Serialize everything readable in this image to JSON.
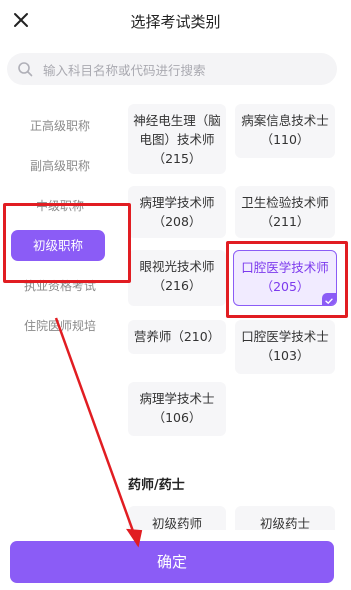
{
  "header": {
    "title": "选择考试类别",
    "close_icon": "close-icon"
  },
  "search": {
    "placeholder": "输入科目名称或代码进行搜索",
    "icon": "search-icon"
  },
  "sidebar": {
    "items": [
      {
        "label": "正高级职称"
      },
      {
        "label": "副高级职称"
      },
      {
        "label": "中级职称"
      },
      {
        "label": "初级职称",
        "active": true
      },
      {
        "label": "执业资格考试"
      },
      {
        "label": "住院医师规培"
      }
    ]
  },
  "cards": [
    {
      "line1": "神经电生理（脑",
      "line2": "电图）技术师",
      "line3": "（215）"
    },
    {
      "line1": "病案信息技术士",
      "line2": "（110）"
    },
    {
      "line1": "病理学技术师",
      "line2": "（208）"
    },
    {
      "line1": "卫生检验技术师",
      "line2": "（211）"
    },
    {
      "line1": "眼视光技术师",
      "line2": "（216）"
    },
    {
      "line1": "口腔医学技术师",
      "line2": "（205）",
      "selected": true
    },
    {
      "line1": "营养师（210）"
    },
    {
      "line1": "口腔医学技术士",
      "line2": "（103）"
    },
    {
      "line1": "病理学技术士",
      "line2": "（106）"
    },
    {
      "line1": "初级药师"
    },
    {
      "line1": "初级药士"
    }
  ],
  "section_title": "药师/药士",
  "confirm_label": "确定",
  "colors": {
    "accent": "#8b5cf6",
    "annotation": "#e11d22"
  }
}
